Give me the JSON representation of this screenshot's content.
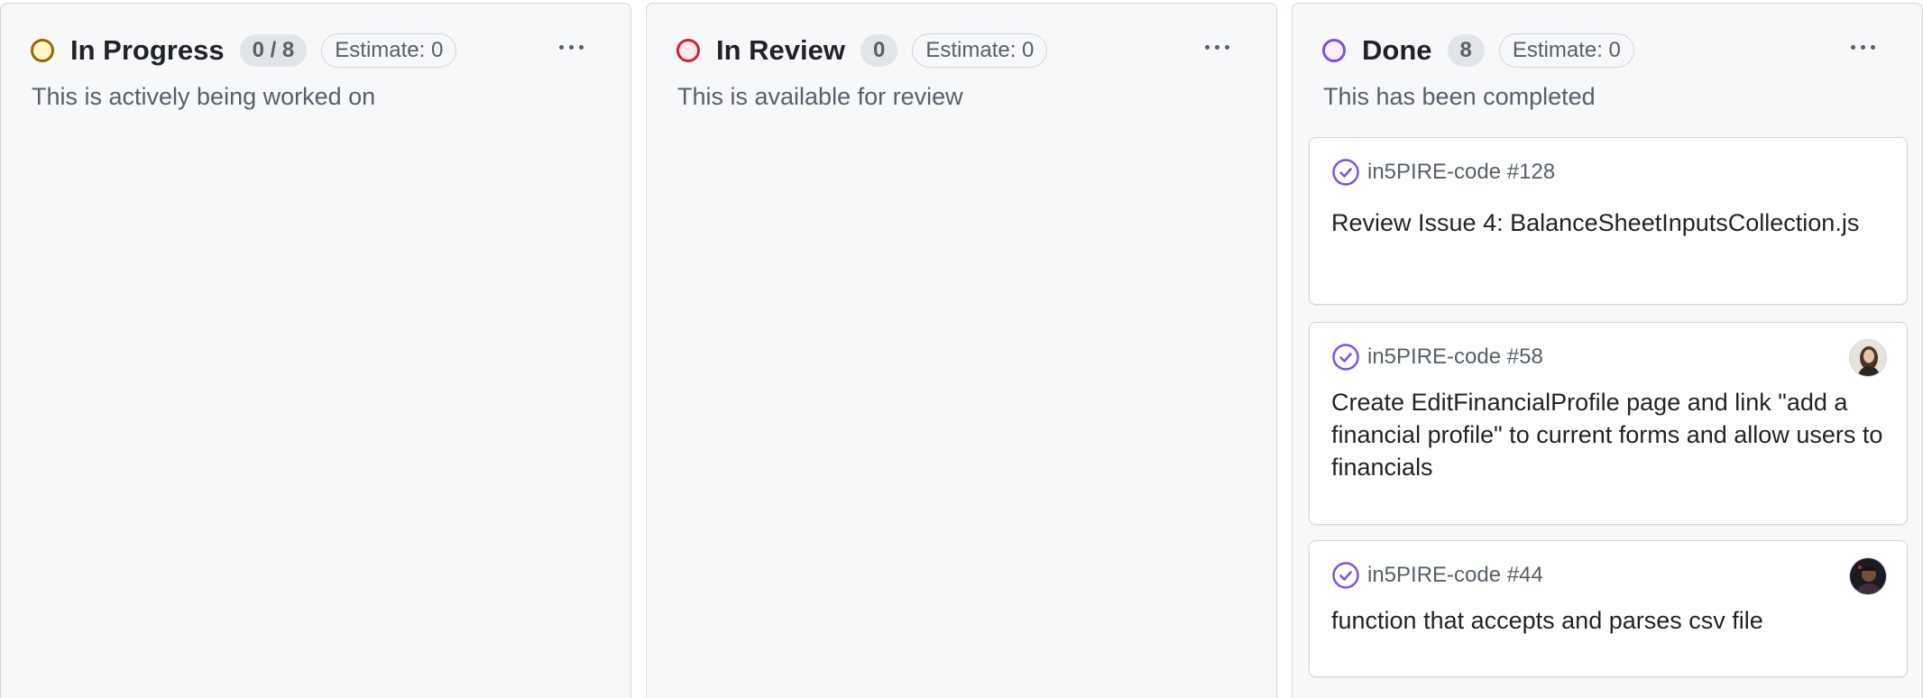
{
  "columns": [
    {
      "title": "In Progress",
      "count": "0 / 8",
      "estimate": "Estimate: 0",
      "description": "This is actively being worked on",
      "status_color": "#9a6700",
      "status_fill": "#fff8c5",
      "cards": []
    },
    {
      "title": "In Review",
      "count": "0",
      "estimate": "Estimate: 0",
      "description": "This is available for review",
      "status_color": "#cf222e",
      "status_fill": "#ffebe9",
      "cards": []
    },
    {
      "title": "Done",
      "count": "8",
      "estimate": "Estimate: 0",
      "description": "This has been completed",
      "status_color": "#8250df",
      "status_fill": "#fbefff",
      "cards": [
        {
          "repo_ref": "in5PIRE-code #128",
          "title": "Review Issue 4: BalanceSheetInputsCollection.js",
          "icon": "issue-closed-icon",
          "has_avatar": false
        },
        {
          "repo_ref": "in5PIRE-code #58",
          "title": "Create EditFinancialProfile page and link \"add a financial profile\" to current forms and allow users to financials",
          "icon": "issue-closed-icon",
          "has_avatar": true
        },
        {
          "repo_ref": "in5PIRE-code #44",
          "title": "function that accepts and parses csv file",
          "icon": "issue-closed-icon",
          "has_avatar": true
        }
      ]
    }
  ],
  "colors": {
    "done_purple": "#8250df",
    "muted_text": "#57606a",
    "primary_text": "#1f2328",
    "column_bg": "#f6f8fa",
    "border": "#d0d7de"
  }
}
